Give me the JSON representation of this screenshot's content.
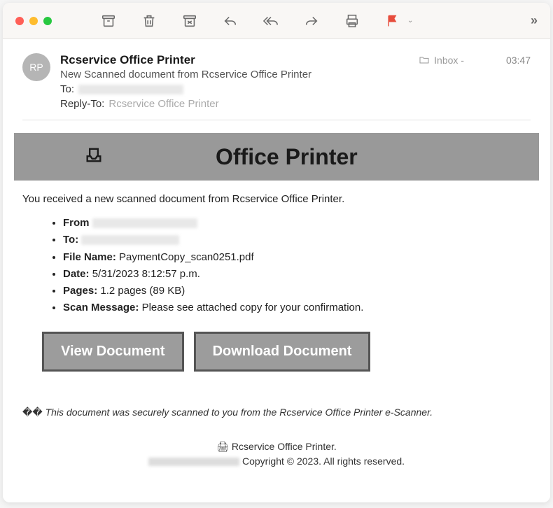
{
  "toolbar": {
    "expand": "»"
  },
  "header": {
    "avatar_initials": "RP",
    "sender_name": "Rcservice Office Printer",
    "folder_label": "Inbox -",
    "time": "03:47",
    "subject": "New Scanned document from Rcservice Office Printer",
    "to_label": "To:",
    "reply_to_label": "Reply-To:",
    "reply_to_value": "Rcservice Office Printer"
  },
  "banner": {
    "title": "Office Printer"
  },
  "body": {
    "intro": "You received a new scanned document from Rcservice Office Printer.",
    "details": {
      "from_label": "From",
      "to_label": "To:",
      "file_label": "File Name:",
      "file_value": "PaymentCopy_scan0251.pdf",
      "date_label": "Date:",
      "date_value": "5/31/2023 8:12:57 p.m.",
      "pages_label": "Pages:",
      "pages_value": "1.2 pages (89 KB)",
      "scanmsg_label": "Scan Message:",
      "scanmsg_value": "Please see attached copy for your confirmation."
    },
    "buttons": {
      "view": "View Document",
      "download": "Download Document"
    },
    "footer_note_prefix": "�� ",
    "footer_note": "This document was securely scanned to you from the Rcservice Office Printer e-Scanner.",
    "signature_line1": "🖨 Rcservice Office Printer.",
    "signature_line2": "Copyright © 2023. All rights reserved."
  }
}
